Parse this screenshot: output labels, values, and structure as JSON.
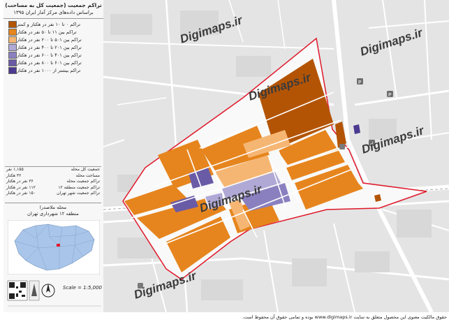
{
  "header": {
    "title": "تراکم جمعیت (جمعیت کل به مساحت)",
    "subtitle": "براساس داده‌های مرکز آمار ایران ۱۳۹۵"
  },
  "legend": {
    "items": [
      {
        "label": "تراکم ۰ تا ۱۰ نفر در هکتار و کمتر",
        "color": "#b35405"
      },
      {
        "label": "تراکم بین ۱۱ تا ۵۰ نفر در هکتار",
        "color": "#e6851e"
      },
      {
        "label": "تراکم بین ۵۰۱ تا ۲۰۰ نفر در هکتار",
        "color": "#f6b673"
      },
      {
        "label": "تراکم بین ۲۰۱ تا ۴۰۰ نفر در هکتار",
        "color": "#b0a9d6"
      },
      {
        "label": "تراکم بین ۴۰۱ تا ۶۰۰ نفر در هکتار",
        "color": "#8a80c0"
      },
      {
        "label": "تراکم بین ۶۰۱ تا ۸۰۰ نفر در هکتار",
        "color": "#6a5ba6"
      },
      {
        "label": "تراکم بیشتر از ۱۰۰۰ نفر در هکتار",
        "color": "#4b3a8f"
      }
    ]
  },
  "stats": [
    {
      "label": "جمعیت کل محله",
      "value": "۱,۱۵۵ نفر"
    },
    {
      "label": "مساحت محله",
      "value": "۳۲ هکتار"
    },
    {
      "label": "تراکم جمعیت محله",
      "value": "۳۶ نفر در هکتار"
    },
    {
      "label": "تراکم جمعیت منطقه ۱۲",
      "value": "۱۱۲ نفر در هکتار"
    },
    {
      "label": "تراکم جمعیت شهر تهران",
      "value": "۱۵۰ نفر در هکتار"
    }
  ],
  "district": {
    "line1": "محله ملاصدرا",
    "line2": "منطقه ۱۲ شهرداری تهران"
  },
  "scale": "Scale = 1:5,000",
  "watermark": "Digimaps.ir",
  "footer": "حقوق مالکیت معنوی این محصول متعلق به سایت www.digimaps.ir بوده و تمامی حقوق آن محفوظ است.",
  "colors": {
    "boundary": "#e0182a",
    "road": "#ffffff",
    "background": "#e4e4e4"
  }
}
